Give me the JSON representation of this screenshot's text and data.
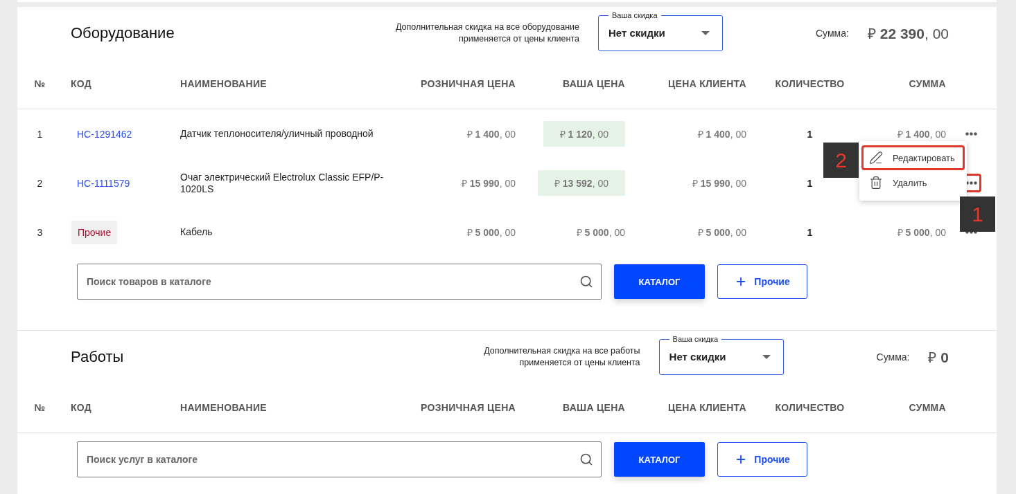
{
  "sections": [
    {
      "title": "Оборудование",
      "discount_note": [
        "Дополнительная скидка на все оборудование",
        "применяется от цены клиента"
      ],
      "discount": {
        "label": "Ваша скидка",
        "value": "Нет скидки"
      },
      "sum_label": "Сумма:",
      "sum": "₽ **22 390**, 00",
      "columns": [
        "№",
        "КОД",
        "НАИМЕНОВАНИЕ",
        "РОЗНИЧНАЯ ЦЕНА",
        "ВАША ЦЕНА",
        "ЦЕНА КЛИЕНТА",
        "КОЛИЧЕСТВО",
        "СУММА"
      ],
      "rows": [
        {
          "number": "1",
          "code": {
            "kind": "link",
            "text": "HC-1291462"
          },
          "name": "Датчик теплоносителя/уличный проводной",
          "retail": "₽ **1 400**, 00",
          "your_price": "₽ **1 120**, 00",
          "your_price_highlighted": true,
          "client_price": "₽ **1 400**, 00",
          "quantity": "1",
          "sum": "₽ **1 400**, 00",
          "actions_highlighted": false
        },
        {
          "number": "2",
          "code": {
            "kind": "link",
            "text": "HC-1111579"
          },
          "name": "Очаг электрический Electrolux Classic EFP/P-1020LS",
          "retail": "₽ **15 990**, 00",
          "your_price": "₽ **13 592**, 00",
          "your_price_highlighted": true,
          "client_price": "₽ **15 990**, 00",
          "quantity": "1",
          "actions_highlighted": true,
          "callout": "1",
          "menu": {
            "items": [
              {
                "kind": "edit",
                "label": "Редактировать",
                "highlighted": true,
                "callout": "2"
              },
              {
                "kind": "delete",
                "label": "Удалить",
                "highlighted": false
              }
            ]
          }
        },
        {
          "number": "3",
          "code": {
            "kind": "tag",
            "text": "Прочие"
          },
          "name": "Кабель",
          "retail": "₽ **5 000**, 00",
          "your_price": "₽ **5 000**, 00",
          "your_price_highlighted": false,
          "client_price": "₽ **5 000**, 00",
          "quantity": "1",
          "sum": "₽ **5 000**, 00"
        }
      ],
      "search": {
        "placeholder": "Поиск товаров в каталоге"
      },
      "catalog_button": "КАТАЛОГ",
      "other_button": "Прочие"
    },
    {
      "title": "Работы",
      "discount_note": [
        "Дополнительная скидка на все работы",
        "применяется от цены клиента"
      ],
      "discount": {
        "label": "Ваша скидка",
        "value": "Нет скидки"
      },
      "sum_label": "Сумма:",
      "sum": "₽ **0**",
      "columns": [
        "№",
        "КОД",
        "НАИМЕНОВАНИЕ",
        "РОЗНИЧНАЯ ЦЕНА",
        "ВАША ЦЕНА",
        "ЦЕНА КЛИЕНТА",
        "КОЛИЧЕСТВО",
        "СУММА"
      ],
      "search": {
        "placeholder": "Поиск услуг в каталоге"
      },
      "catalog_button": "КАТАЛОГ",
      "other_button": "Прочие"
    }
  ]
}
